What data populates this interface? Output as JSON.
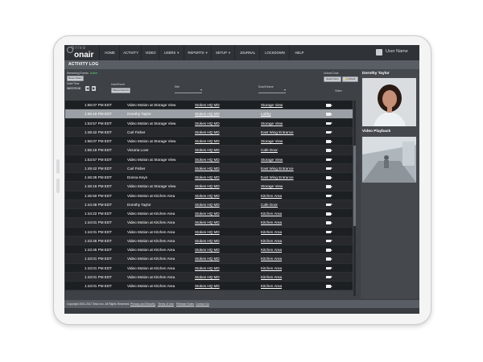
{
  "app": {
    "brand_top": "brivo",
    "brand_bottom": "onair",
    "user_name": "User Name"
  },
  "nav": [
    {
      "label": "HOME",
      "caret": ""
    },
    {
      "label": "ACTIVITY",
      "caret": ""
    },
    {
      "label": "VIDEO",
      "caret": ""
    },
    {
      "label": "USERS",
      "caret": "▼"
    },
    {
      "label": "REPORTS",
      "caret": "▼"
    },
    {
      "label": "SETUP",
      "caret": "▼"
    },
    {
      "label": "JOURNAL",
      "caret": ""
    },
    {
      "label": "LOCKDOWN",
      "caret": ""
    },
    {
      "label": "HELP",
      "caret": ""
    }
  ],
  "page_title": "ACTIVITY LOG",
  "controls": {
    "streaming_label": "Streaming Events",
    "streaming_status": "Active",
    "pause_button": "Reset Filters",
    "date_label": "Date/Time",
    "date_value": "06/07/2018",
    "prev_arrow": "◀",
    "next_arrow": "▶",
    "user_event_label": "User/Event",
    "filter_button": "Filtered Events",
    "site_label": "Site",
    "door_label": "Door/Device",
    "unlock_label": "Unlock Door",
    "select_door_button": "Select Door",
    "unlock_button": "Unlock",
    "video_col_label": "Video"
  },
  "rows": [
    {
      "time": "1:56:07 PM EDT",
      "desc": "Video Motion at Storage View",
      "site": "Stokes HQ MD",
      "device": "Storage View"
    },
    {
      "time": "1:55:18 PM EDT",
      "desc": "Dorothy Taylor",
      "site": "Stokes HQ MD",
      "device": "Lobby"
    },
    {
      "time": "1:53:57 PM EDT",
      "desc": "Video Motion at Storage View",
      "site": "Stokes HQ MD",
      "device": "Storage View"
    },
    {
      "time": "1:49:42 PM EDT",
      "desc": "Carl Fisher",
      "site": "Stokes HQ MD",
      "device": "East Wing Entrance"
    },
    {
      "time": "1:56:07 PM EDT",
      "desc": "Video Motion at Storage View",
      "site": "Stokes HQ MD",
      "device": "Storage View"
    },
    {
      "time": "1:55:18 PM EDT",
      "desc": "Victoria Love",
      "site": "Stokes HQ MD",
      "device": "Cafe Door"
    },
    {
      "time": "1:53:57 PM EDT",
      "desc": "Video Motion at Storage View",
      "site": "Stokes HQ MD",
      "device": "Storage View"
    },
    {
      "time": "1:49:42 PM EDT",
      "desc": "Carl Fisher",
      "site": "Stokes HQ MD",
      "device": "East Wing Entrance"
    },
    {
      "time": "1:46:36 PM EDT",
      "desc": "Donna Keys",
      "site": "Stokes HQ MD",
      "device": "East Wing Entrance"
    },
    {
      "time": "1:46:16 PM EDT",
      "desc": "Video Motion at Storage View",
      "site": "Stokes HQ MD",
      "device": "Storage View"
    },
    {
      "time": "1:45:50 PM EDT",
      "desc": "Video Motion at Kitchen Area",
      "site": "Stokes HQ MD",
      "device": "Kitchen Area"
    },
    {
      "time": "1:44:48 PM EDT",
      "desc": "Dorothy Taylor",
      "site": "Stokes HQ MD",
      "device": "Cafe Door"
    },
    {
      "time": "1:44:22 PM EDT",
      "desc": "Video Motion at Kitchen Area",
      "site": "Stokes HQ MD",
      "device": "Kitchen Area"
    },
    {
      "time": "1:44:01 PM EDT",
      "desc": "Video Motion at Kitchen Area",
      "site": "Stokes HQ MD",
      "device": "Kitchen Area"
    },
    {
      "time": "1:44:01 PM EDT",
      "desc": "Video Motion at Kitchen Area",
      "site": "Stokes HQ MD",
      "device": "Kitchen Area"
    },
    {
      "time": "1:43:45 PM EDT",
      "desc": "Video Motion at Kitchen Area",
      "site": "Stokes HQ MD",
      "device": "Kitchen Area"
    },
    {
      "time": "1:43:45 PM EDT",
      "desc": "Video Motion at Kitchen Area",
      "site": "Stokes HQ MD",
      "device": "Kitchen Area"
    },
    {
      "time": "1:43:01 PM EDT",
      "desc": "Video Motion at Kitchen Area",
      "site": "Stokes HQ MD",
      "device": "Kitchen Area"
    },
    {
      "time": "1:43:01 PM EDT",
      "desc": "Video Motion at Kitchen Area",
      "site": "Stokes HQ MD",
      "device": "Kitchen Area"
    },
    {
      "time": "1:43:01 PM EDT",
      "desc": "Video Motion at Kitchen Area",
      "site": "Stokes HQ MD",
      "device": "Kitchen Area"
    },
    {
      "time": "1:43:01 PM EDT",
      "desc": "Video Motion at Kitchen Area",
      "site": "Stokes HQ MD",
      "device": "Kitchen Area"
    }
  ],
  "selected_row": 1,
  "side": {
    "person_name": "Dorothy Taylor",
    "video_title": "Video Playback"
  },
  "footer": {
    "copyright": "Copyright 2001-2017 Brivo Inc. All Rights Reserved.",
    "privacy": "Privacy and Security",
    "terms": "Terms of Use",
    "release": "Release Notes",
    "contact": "Contact Us"
  },
  "colors": {
    "screen_bg": "#3e4247",
    "row_selected": "#9aa0a5",
    "status_active": "#5cd16a"
  }
}
